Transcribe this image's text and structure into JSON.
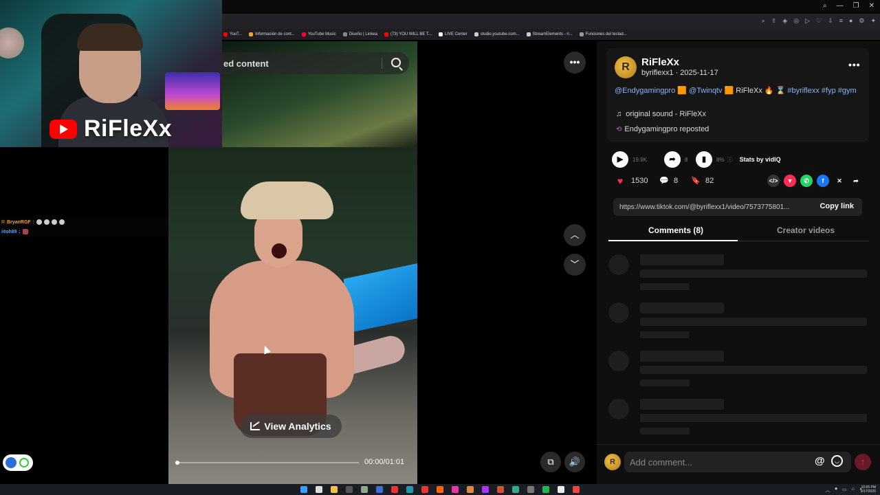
{
  "browser": {
    "bookmarks": [
      {
        "label": "YouT...",
        "color": "#ff0000"
      },
      {
        "label": "Información de cont...",
        "color": "#e8a33c"
      },
      {
        "label": "YouTube Music",
        "color": "#ff0033"
      },
      {
        "label": "Diseño | Linkea",
        "color": "#888888"
      },
      {
        "label": "(73) YOU WILL BE T...",
        "color": "#ff0000"
      },
      {
        "label": "LIVE Center",
        "color": "#ffffff"
      },
      {
        "label": "studio.youtube.com...",
        "color": "#cccccc"
      },
      {
        "label": "StreamElements - ri...",
        "color": "#cccccc"
      },
      {
        "label": "Funciones del teclad...",
        "color": "#999999"
      }
    ],
    "window_controls": [
      "—",
      "❐",
      "✕"
    ]
  },
  "webcam": {
    "channel_name": "RiFleXx"
  },
  "chat": {
    "messages": [
      {
        "user": "BryanRGF",
        "user_color": "#e8a33c",
        "prefix": "R",
        "sep": ":"
      },
      {
        "user": "iitoh89",
        "user_color": "#4aa3ff",
        "prefix": "",
        "sep": ":"
      }
    ]
  },
  "video": {
    "search_text": "ed content",
    "view_analytics_label": "View Analytics",
    "time_readout": "00:00/01:01",
    "progress": 0.0
  },
  "post": {
    "author_name": "RiFleXx",
    "author_handle": "byriflexx1",
    "date": "2025-11-17",
    "avatar_letter": "R",
    "caption_parts": [
      {
        "text": "@Endygamingpro",
        "tag": true
      },
      {
        "text": " 🟧 ",
        "tag": false
      },
      {
        "text": "@Twinqtv",
        "tag": true
      },
      {
        "text": " 🟧 RiFleXx 🔥 ⌛ ",
        "tag": false
      },
      {
        "text": "#byriflexx",
        "tag": true
      },
      {
        "text": " ",
        "tag": false
      },
      {
        "text": "#fyp",
        "tag": true
      },
      {
        "text": " ",
        "tag": false
      },
      {
        "text": "#gym",
        "tag": true
      }
    ],
    "music": "original sound - RiFleXx",
    "repost_text": "Endygamingpro reposted"
  },
  "stats": {
    "views": "19.9K",
    "shares": "8",
    "engagement": "8%",
    "stats_by_label": "Stats by vidIQ",
    "likes": "1530",
    "comments": "8",
    "saves": "82"
  },
  "share": {
    "link": "https://www.tiktok.com/@byriflexx1/video/7573775801...",
    "copy_label": "Copy link"
  },
  "tabs": {
    "comments_label": "Comments (8)",
    "creator_videos_label": "Creator videos"
  },
  "comment_box": {
    "placeholder": "Add comment...",
    "at_symbol": "@"
  },
  "taskbar": {
    "time": "10:55 PM",
    "date": "9/17/2025"
  },
  "colors": {
    "accent_red": "#fe2c55",
    "link_blue": "#8ab4f8",
    "background": "#000000"
  }
}
